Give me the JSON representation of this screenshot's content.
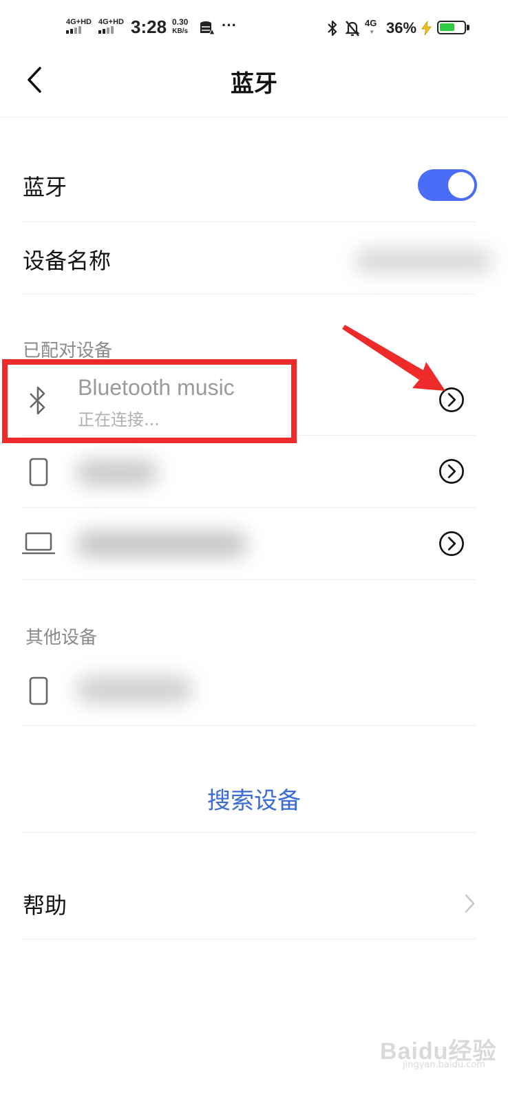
{
  "status_bar": {
    "sim1_label": "4G+HD",
    "sim2_label": "4G+HD",
    "time": "3:28",
    "net_speed_value": "0.30",
    "net_speed_unit": "KB/s",
    "mobile_data_label": "4G",
    "battery_percent": "36%",
    "battery_level": 0.36,
    "more_label": "···"
  },
  "header": {
    "title": "蓝牙"
  },
  "bluetooth_row": {
    "label": "蓝牙",
    "enabled": true,
    "accent_color": "#4a6cf7"
  },
  "device_name_row": {
    "label": "设备名称"
  },
  "paired_section": {
    "label": "已配对设备",
    "devices": [
      {
        "name": "Bluetooth music",
        "status": "正在连接...",
        "icon": "bluetooth-icon"
      },
      {
        "name": "",
        "status": "",
        "icon": "phone-icon"
      },
      {
        "name": "",
        "status": "",
        "icon": "laptop-icon"
      }
    ]
  },
  "other_section": {
    "label": "其他设备",
    "devices": [
      {
        "name": "",
        "icon": "phone-icon"
      }
    ]
  },
  "search_button": {
    "label": "搜索设备"
  },
  "help_row": {
    "label": "帮助"
  },
  "watermark": {
    "text": "Baidu经验",
    "subtext": "jingyan.baidu.com"
  },
  "annotation_color": "#ee2a2a"
}
